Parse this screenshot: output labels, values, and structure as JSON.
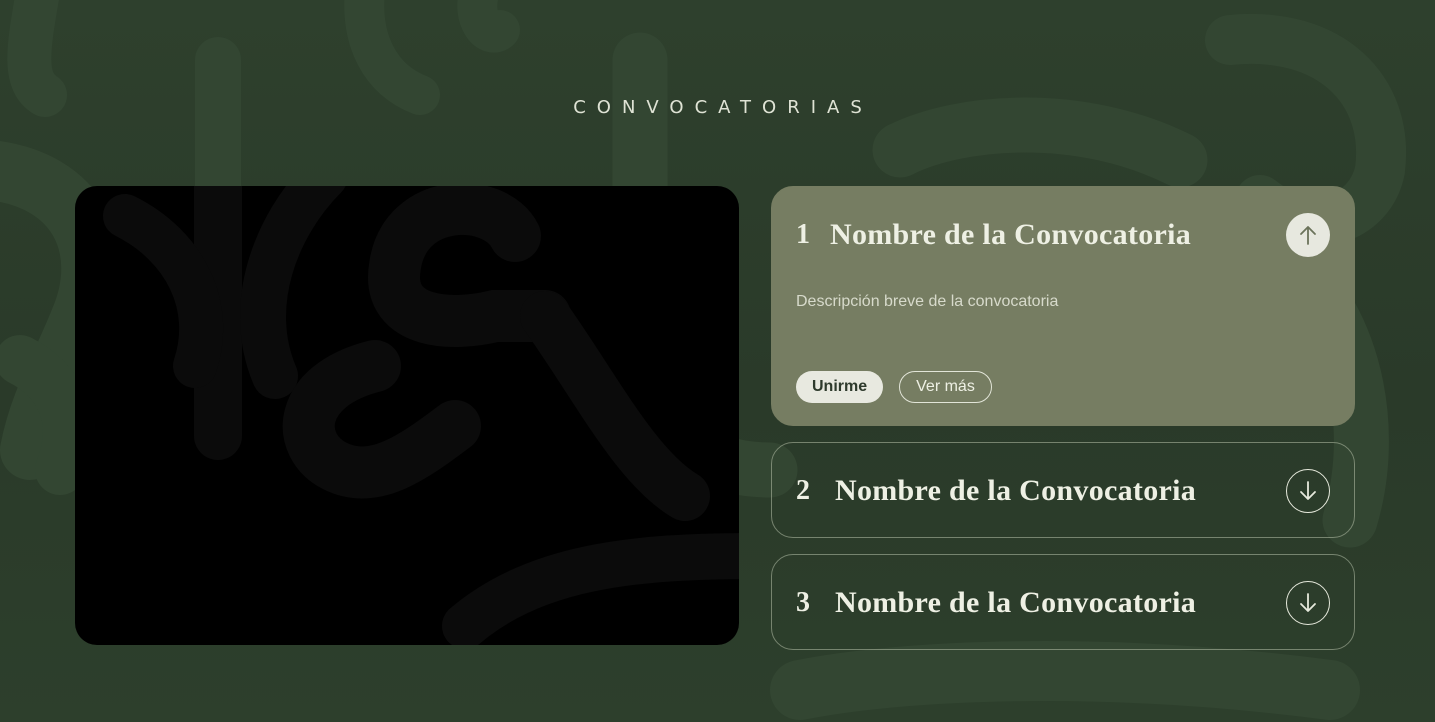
{
  "section": {
    "title": "CONVOCATORIAS"
  },
  "convocatorias": [
    {
      "number": "1",
      "name": "Nombre de la Convocatoria",
      "expanded": true,
      "toggle_icon": "arrow-up-icon",
      "description": "Descripción breve de la convocatoria",
      "primary_action": "Unirme",
      "secondary_action": "Ver más"
    },
    {
      "number": "2",
      "name": "Nombre de la Convocatoria",
      "expanded": false,
      "toggle_icon": "arrow-down-icon"
    },
    {
      "number": "3",
      "name": "Nombre de la Convocatoria",
      "expanded": false,
      "toggle_icon": "arrow-down-icon"
    }
  ],
  "colors": {
    "background": "#2c3d2b",
    "active_card": "#767d62",
    "text": "#eef0e4",
    "media": "#000000"
  }
}
